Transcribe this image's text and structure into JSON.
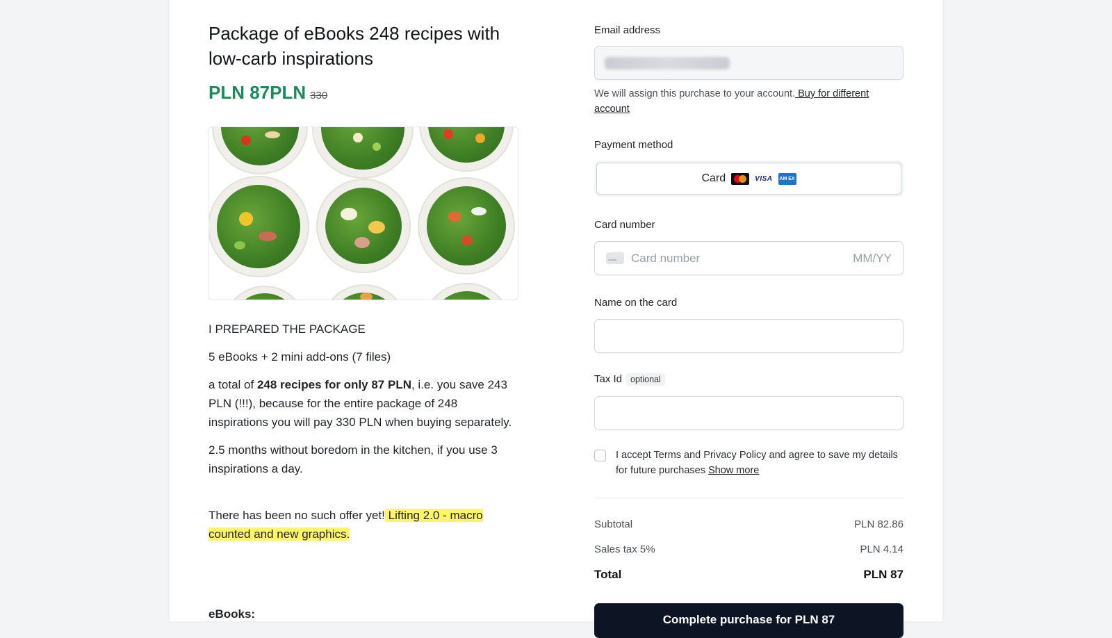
{
  "product": {
    "title": "Package of eBooks 248 recipes with low-carb inspirations",
    "price_current": "PLN 87PLN",
    "price_old": "330",
    "price_color": "#1a8a5a"
  },
  "description": {
    "p1": "I PREPARED THE PACKAGE",
    "p2": "5 eBooks + 2 mini add-ons (7 files)",
    "p3_a": "a total of ",
    "p3_bold": "248 recipes for only 87 PLN",
    "p3_b": ", i.e. you save 243 PLN (!!!), because for the entire package of 248 inspirations you will pay 330 PLN when buying separately.",
    "p4": "2.5 months without boredom in the kitchen, if you use 3 inspirations a day.",
    "p5_a": "There has been no such offer yet!",
    "p5_highlight": " Lifting 2.0 - macro counted and new graphics.",
    "ebooks_heading": "eBooks:"
  },
  "checkout": {
    "email_label": "Email address",
    "account_note": "We will assign this purchase to your account.",
    "account_link": " Buy for different account",
    "payment_label": "Payment method",
    "payment_card": "Card",
    "card_brands": [
      "mastercard-icon",
      "visa-icon",
      "amex-icon"
    ],
    "visa_text": "VISA",
    "amex_text": "AM EX",
    "card_number_label": "Card number",
    "card_number_placeholder": "Card number",
    "expiry_placeholder": "MM/YY",
    "name_label": "Name on the card",
    "tax_label": "Tax Id",
    "tax_optional": "optional",
    "consent_text": "I accept Terms and Privacy Policy and agree to save my details for future purchases ",
    "consent_link": "Show more",
    "subtotal_label": "Subtotal",
    "subtotal_value": "PLN 82.86",
    "tax_row_label": "Sales tax 5%",
    "tax_row_value": "PLN 4.14",
    "total_label": "Total",
    "total_value": "PLN 87",
    "button_label": "Complete purchase for PLN 87",
    "button_color": "#0d1524"
  }
}
